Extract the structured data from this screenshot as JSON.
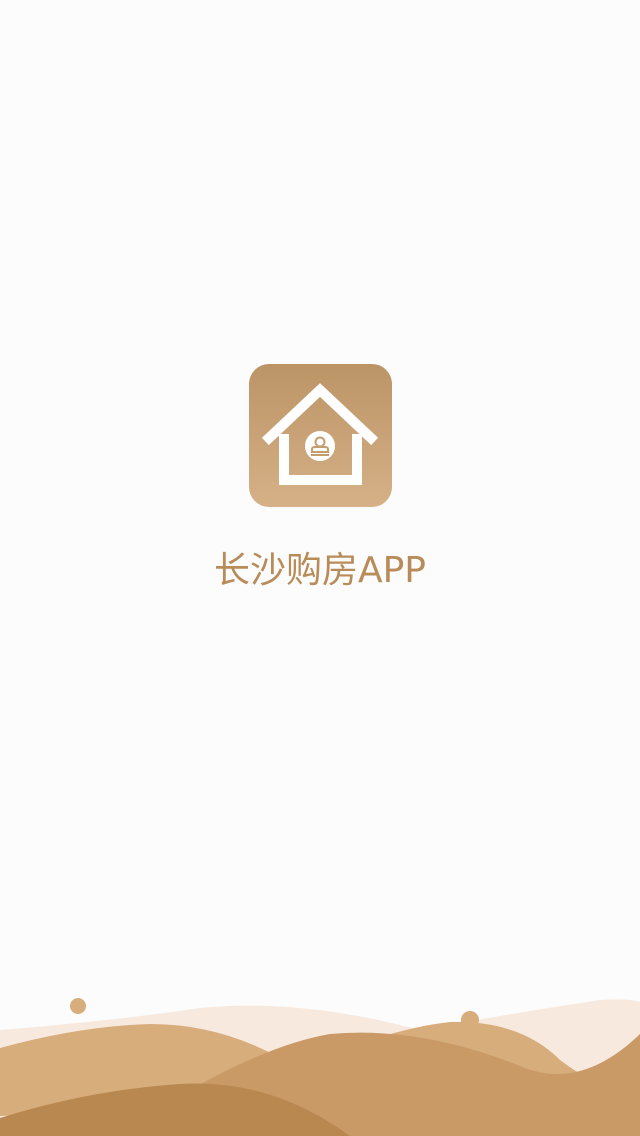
{
  "app": {
    "name": "长沙购房APP",
    "icon": "house-with-seal-icon"
  },
  "colors": {
    "background": "#fcfcfc",
    "icon_gradient_top": "#bb9466",
    "icon_gradient_bottom": "#d6b187",
    "title_text": "#b88c59",
    "hill_light": "#f8e9df",
    "hill_mid": "#d7ad7c",
    "hill_dark": "#c99966",
    "hill_darkest": "#b98850"
  }
}
